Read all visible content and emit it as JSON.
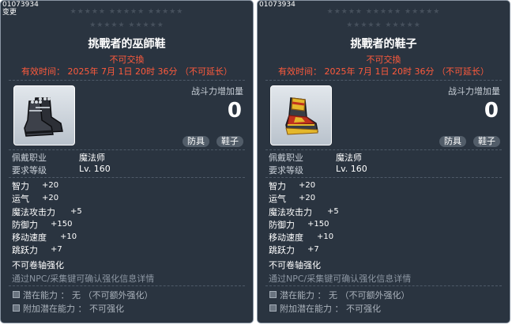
{
  "tooltips": [
    {
      "item_id": "01073934",
      "change_label": "变更",
      "stars_row1": "★★★★★  ★★★★★  ★★★★★",
      "stars_row2": "★★★★★  ★★★★★",
      "title": "挑戰者的巫師鞋",
      "trade_status": "不可交換",
      "expiry": "有效时间： 2025年 7月 1日 20时 36分 （不可延长）",
      "icon": "dark-boots-icon",
      "combat_power_label": "战斗力增加量",
      "combat_power_value": "0",
      "tags": [
        "防具",
        "鞋子"
      ],
      "requirements": [
        {
          "label": "佩戴职业",
          "value": "魔法师"
        },
        {
          "label": "要求等级",
          "value": "Lv. 160"
        }
      ],
      "stats": [
        {
          "name": "智力",
          "value": "+20"
        },
        {
          "name": "运气",
          "value": "+20"
        },
        {
          "name": "魔法攻击力",
          "value": "+5"
        },
        {
          "name": "防御力",
          "value": "+150"
        },
        {
          "name": "移动速度",
          "value": "+10"
        },
        {
          "name": "跳跃力",
          "value": "+7"
        }
      ],
      "star_force_note": "不可卷轴强化",
      "enhance_hint": "通过NPC/采集键可确认强化信息详情",
      "potentials": [
        {
          "label": "潜在能力 ： 无 （不可额外强化）"
        },
        {
          "label": "附加潜在能力 ： 不可强化"
        }
      ]
    },
    {
      "item_id": "01073934",
      "stars_row1": "★★★★★  ★★★★★  ★★★★★",
      "stars_row2": "★★★★★  ★★★★★",
      "title": "挑戰者的鞋子",
      "trade_status": "不可交換",
      "expiry": "有效时间： 2025年 7月 1日 20时 36分 （不可延长）",
      "icon": "red-gold-boots-icon",
      "combat_power_label": "战斗力增加量",
      "combat_power_value": "0",
      "tags": [
        "防具",
        "鞋子"
      ],
      "requirements": [
        {
          "label": "佩戴职业",
          "value": "魔法师"
        },
        {
          "label": "要求等级",
          "value": "Lv. 160"
        }
      ],
      "stats": [
        {
          "name": "智力",
          "value": "+20"
        },
        {
          "name": "运气",
          "value": "+20"
        },
        {
          "name": "魔法攻击力",
          "value": "+5"
        },
        {
          "name": "防御力",
          "value": "+150"
        },
        {
          "name": "移动速度",
          "value": "+10"
        },
        {
          "name": "跳跃力",
          "value": "+7"
        }
      ],
      "star_force_note": "不可卷轴强化",
      "enhance_hint": "通过NPC/采集键可确认强化信息详情",
      "potentials": [
        {
          "label": "潜在能力 ： 无 （不可额外强化）"
        },
        {
          "label": "附加潜在能力 ： 不可强化"
        }
      ]
    }
  ]
}
